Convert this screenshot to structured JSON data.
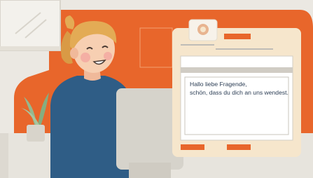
{
  "message": {
    "line1": "Hallo liebe Fragende,",
    "line2": "schön, dass du dich an uns wendest."
  },
  "colors": {
    "background": "#ebe8e2",
    "accent_orange": "#e8662b",
    "window_frame": "#f3f1ec",
    "monitor_cream": "#f6e6cc",
    "monitor_back": "#d6d3cb",
    "sweater": "#2f5d86",
    "hair": "#e3ab55",
    "skin": "#f7cfb2",
    "plant": "#95b88e",
    "text": "#2c3e55"
  },
  "icons": {
    "person": "woman-at-computer-illustration",
    "plant": "potted-plant-illustration",
    "window": "window-illustration",
    "webcam": "webcam-icon"
  }
}
